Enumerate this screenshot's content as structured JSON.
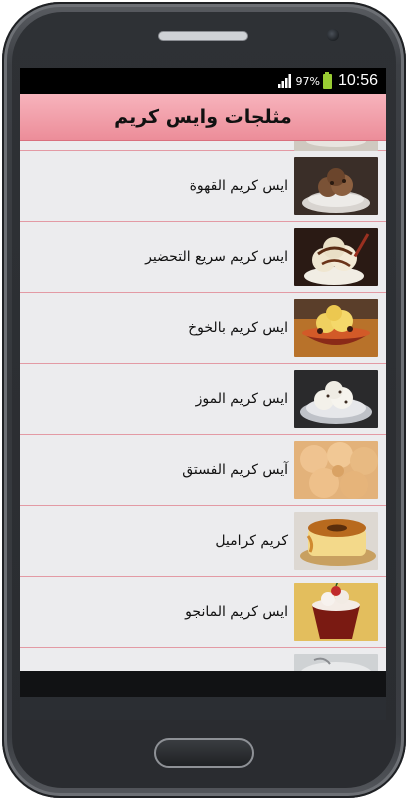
{
  "status_bar": {
    "battery_percent": "97%",
    "time": "10:56",
    "signal_icon": "signal-bars-icon",
    "battery_icon": "battery-icon",
    "battery_color": "#99cc33"
  },
  "app": {
    "title": "مثلجات وايس كريم",
    "accent_color": "#ec8d99"
  },
  "recipes": [
    {
      "label": "ايس كريم القهوة",
      "thumb": "coffee-ice-cream"
    },
    {
      "label": "ايس كريم سريع التحضير",
      "thumb": "quick-ice-cream"
    },
    {
      "label": "ايس كريم بالخوخ",
      "thumb": "peach-ice-cream"
    },
    {
      "label": "ايس كريم الموز",
      "thumb": "banana-ice-cream"
    },
    {
      "label": "آيس كريم الفستق",
      "thumb": "pistachio-ice-cream"
    },
    {
      "label": "كريم كراميل",
      "thumb": "creme-caramel"
    },
    {
      "label": "ايس كريم المانجو",
      "thumb": "mango-ice-cream"
    }
  ]
}
